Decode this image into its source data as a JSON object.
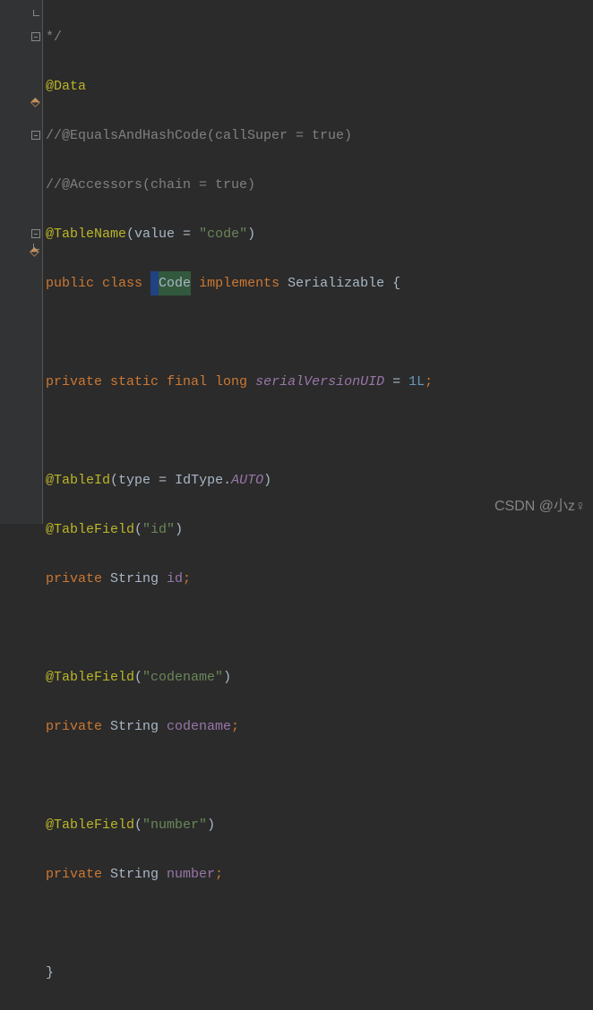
{
  "gutter": {
    "comment_close": "*/"
  },
  "code": {
    "l1": "*/",
    "data_anno": "@Data",
    "eq_hash": "//@EqualsAndHashCode(callSuper = true)",
    "accessors": "//@Accessors(chain = true)",
    "tn_anno": "@TableName",
    "tn_value_kw": "value ",
    "tn_eq": "= ",
    "tn_value": "\"code\"",
    "public": "public ",
    "class_kw": "class ",
    "class_name": "Code",
    "space": " ",
    "implements": "implements ",
    "serializable": "Serializable ",
    "lbrace": "{",
    "private": "private ",
    "static": "static ",
    "final": "final ",
    "long": "long ",
    "svuid": "serialVersionUID ",
    "eq": "= ",
    "svuid_val": "1L",
    "semi": ";",
    "tableid_anno": "@TableId",
    "type_kw": "type ",
    "idtype": "IdType",
    "dot": ".",
    "auto": "AUTO",
    "tablefield_anno": "@TableField",
    "tf_id": "\"id\"",
    "string_type": "String ",
    "field_id": "id",
    "tf_codename": "\"codename\"",
    "field_codename": "codename",
    "tf_number": "\"number\"",
    "field_number": "number",
    "rbrace": "}",
    "lparen": "(",
    "rparen": ")"
  },
  "watermark": "CSDN @小z♀"
}
